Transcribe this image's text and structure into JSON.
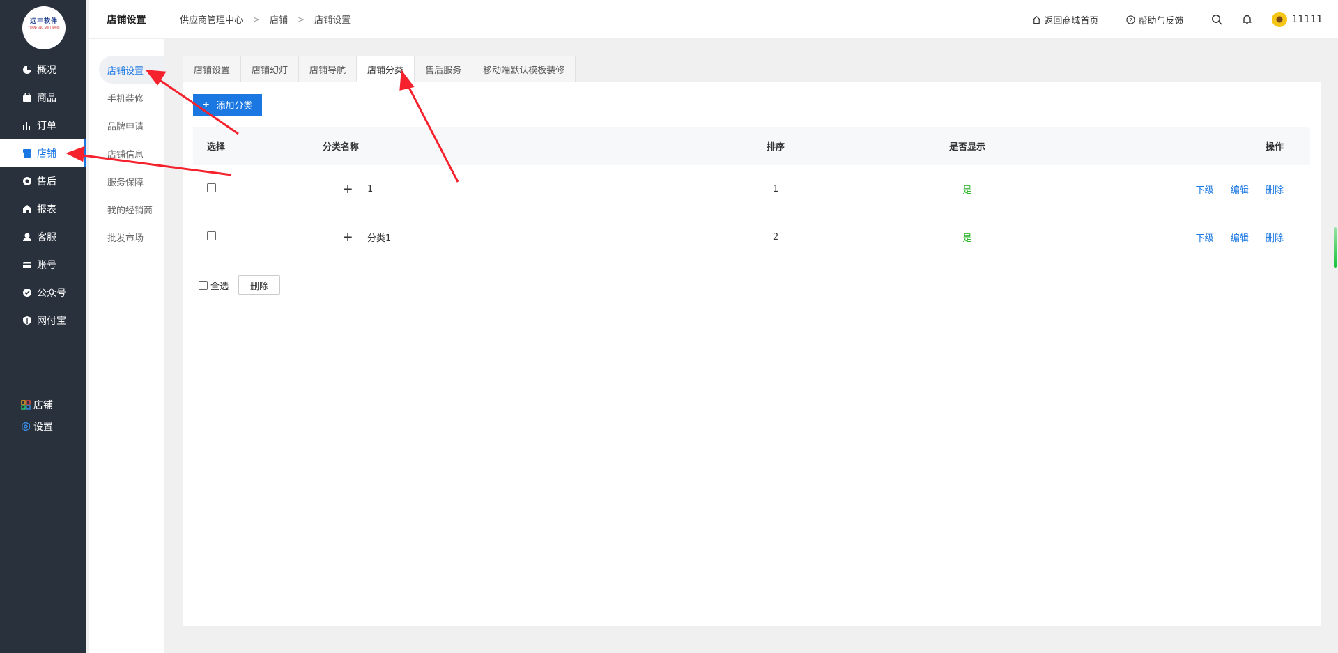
{
  "logo": {
    "text": "远丰软件",
    "sub": "YUANFENG SOFTWARE"
  },
  "nav": {
    "items": [
      {
        "label": "概况",
        "icon": "pie-chart-icon"
      },
      {
        "label": "商品",
        "icon": "bag-icon"
      },
      {
        "label": "订单",
        "icon": "bar-chart-icon"
      },
      {
        "label": "店铺",
        "icon": "store-icon",
        "active": true
      },
      {
        "label": "售后",
        "icon": "service-icon"
      },
      {
        "label": "报表",
        "icon": "report-icon"
      },
      {
        "label": "客服",
        "icon": "headset-icon"
      },
      {
        "label": "账号",
        "icon": "card-icon"
      },
      {
        "label": "公众号",
        "icon": "badge-check-icon"
      },
      {
        "label": "网付宝",
        "icon": "shield-icon"
      }
    ],
    "bottom": [
      {
        "label": "店铺",
        "icon": "apps-grid-icon"
      },
      {
        "label": "设置",
        "icon": "hexagon-gear-icon"
      }
    ]
  },
  "subnav": {
    "title": "店铺设置",
    "items": [
      "店铺设置",
      "手机装修",
      "品牌申请",
      "店铺信息",
      "服务保障",
      "我的经销商",
      "批发市场"
    ]
  },
  "header": {
    "breadcrumb": [
      "供应商管理中心",
      "店铺",
      "店铺设置"
    ],
    "home_link": "返回商城首页",
    "help_link": "帮助与反馈",
    "username": "11111"
  },
  "tabs": [
    "店铺设置",
    "店铺幻灯",
    "店铺导航",
    "店铺分类",
    "售后服务",
    "移动端默认模板装修"
  ],
  "add_button": "添加分类",
  "table": {
    "headers": {
      "select": "选择",
      "name": "分类名称",
      "sort": "排序",
      "show": "是否显示",
      "ops": "操作"
    },
    "rows": [
      {
        "name": "1",
        "sort": "1",
        "show": "是"
      },
      {
        "name": "分类1",
        "sort": "2",
        "show": "是"
      }
    ],
    "op_labels": {
      "child": "下级",
      "edit": "编辑",
      "delete": "删除"
    },
    "expand_symbol": "+"
  },
  "footer": {
    "select_all": "全选",
    "delete": "删除"
  },
  "colors": {
    "accent": "#1b78e3",
    "sidebar": "#29313d",
    "green": "#1aad19",
    "arrow": "#f5222d"
  }
}
